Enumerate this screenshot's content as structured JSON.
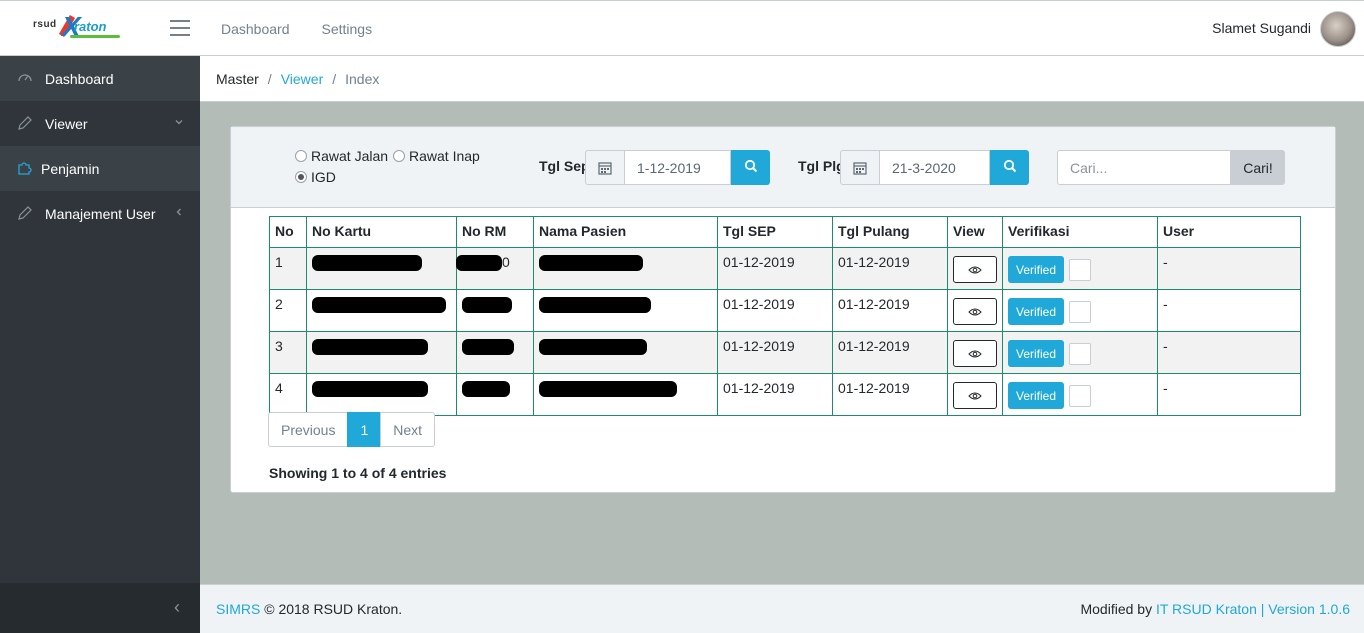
{
  "header": {
    "brand": {
      "prefix": "rsud",
      "x": "X",
      "name": "raton"
    },
    "nav": [
      {
        "label": "Dashboard"
      },
      {
        "label": "Settings"
      }
    ],
    "user": {
      "name": "Slamet Sugandi"
    }
  },
  "sidebar": {
    "items": [
      {
        "label": "Dashboard",
        "icon": "speedometer-icon"
      },
      {
        "label": "Viewer",
        "icon": "pencil-icon",
        "caret": "chevron-down-icon"
      },
      {
        "label": "Penjamin",
        "icon": "puzzle-icon"
      },
      {
        "label": "Manajement User",
        "icon": "pencil-icon",
        "caret": "chevron-left-icon"
      }
    ],
    "minimizer": "‹"
  },
  "breadcrumb": {
    "items": [
      "Master",
      "Viewer",
      "Index"
    ],
    "separator": "/"
  },
  "filters": {
    "radios": [
      {
        "label": "Rawat Jalan",
        "checked": false
      },
      {
        "label": "Rawat Inap",
        "checked": false
      },
      {
        "label": "IGD",
        "checked": true
      }
    ],
    "tgl_sep": {
      "label": "Tgl Sep",
      "value": "1-12-2019"
    },
    "tgl_plg": {
      "label": "Tgl Plg",
      "value": "21-3-2020"
    },
    "search": {
      "placeholder": "Cari...",
      "button": "Cari!"
    }
  },
  "table": {
    "columns": [
      "No",
      "No Kartu",
      "No RM",
      "Nama Pasien",
      "Tgl SEP",
      "Tgl Pulang",
      "View",
      "Verifikasi",
      "User"
    ],
    "rows": [
      {
        "no": "1",
        "no_kartu": "",
        "no_rm": "0",
        "nama": "",
        "tgl_sep": "01-12-2019",
        "tgl_pulang": "01-12-2019",
        "verif": "Verified",
        "user": "-"
      },
      {
        "no": "2",
        "no_kartu": "",
        "no_rm": "",
        "nama": "",
        "tgl_sep": "01-12-2019",
        "tgl_pulang": "01-12-2019",
        "verif": "Verified",
        "user": "-"
      },
      {
        "no": "3",
        "no_kartu": "",
        "no_rm": "",
        "nama": "",
        "tgl_sep": "01-12-2019",
        "tgl_pulang": "01-12-2019",
        "verif": "Verified",
        "user": "-"
      },
      {
        "no": "4",
        "no_kartu": "",
        "no_rm": "",
        "nama": "",
        "tgl_sep": "01-12-2019",
        "tgl_pulang": "01-12-2019",
        "verif": "Verified",
        "user": "-"
      }
    ]
  },
  "pagination": {
    "previous": "Previous",
    "current": "1",
    "next": "Next"
  },
  "showing": {
    "prefix": "Showing ",
    "from": "1",
    "to_word": " to ",
    "to": "4",
    "of_word": " of ",
    "total": "4",
    "suffix": " entries"
  },
  "footer": {
    "app": "SIMRS",
    "copyright": " © 2018 RSUD Kraton.",
    "modified_prefix": "Modified by ",
    "modified_link": "IT RSUD Kraton | Version 1.0.6"
  },
  "colors": {
    "accent": "#20a8d8",
    "sidebar": "#2f353a",
    "table_border": "#1e8a6e",
    "content_bg": "#b4bcb7"
  }
}
